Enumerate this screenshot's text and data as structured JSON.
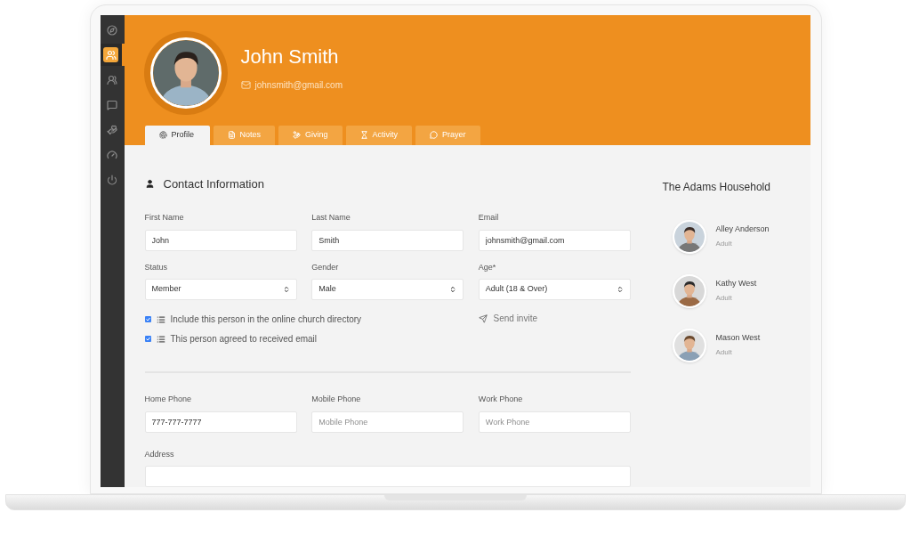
{
  "sidebar": {
    "items": [
      {
        "selected": false
      },
      {
        "selected": true
      },
      {
        "selected": false
      },
      {
        "selected": false
      },
      {
        "selected": false
      },
      {
        "selected": false
      },
      {
        "selected": false
      }
    ]
  },
  "profile": {
    "name": "John Smith",
    "email": "johnsmith@gmail.com"
  },
  "tabs": [
    {
      "label": "Profile",
      "selected": true
    },
    {
      "label": "Notes",
      "selected": false
    },
    {
      "label": "Giving",
      "selected": false
    },
    {
      "label": "Activity",
      "selected": false
    },
    {
      "label": "Prayer",
      "selected": false
    }
  ],
  "contact": {
    "title": "Contact Information",
    "fields": [
      {
        "label": "First Name",
        "kind": "text",
        "value": "John"
      },
      {
        "label": "Last Name",
        "kind": "text",
        "value": "Smith"
      },
      {
        "label": "Email",
        "kind": "text",
        "value": "johnsmith@gmail.com"
      },
      {
        "label": "Status",
        "kind": "select",
        "value": "Member"
      },
      {
        "label": "Gender",
        "kind": "select",
        "value": "Male"
      },
      {
        "label": "Age*",
        "kind": "select",
        "value": "Adult (18 & Over)"
      }
    ],
    "options": [
      {
        "label": "Include this person in the online church directory",
        "checked": true
      },
      {
        "label": "This person agreed to received email",
        "checked": true
      }
    ],
    "send_invite": "Send invite",
    "phones": [
      {
        "label": "Home Phone",
        "value": "777-777-7777"
      },
      {
        "label": "Mobile Phone",
        "placeholder": "Mobile Phone"
      },
      {
        "label": "Work Phone",
        "placeholder": "Work Phone"
      }
    ],
    "address": {
      "label": "Address"
    }
  },
  "household": {
    "title": "The Adams Household",
    "members": [
      {
        "name": "Alley Anderson",
        "role": "Adult"
      },
      {
        "name": "Kathy West",
        "role": "Adult"
      },
      {
        "name": "Mason West",
        "role": "Adult"
      }
    ]
  }
}
